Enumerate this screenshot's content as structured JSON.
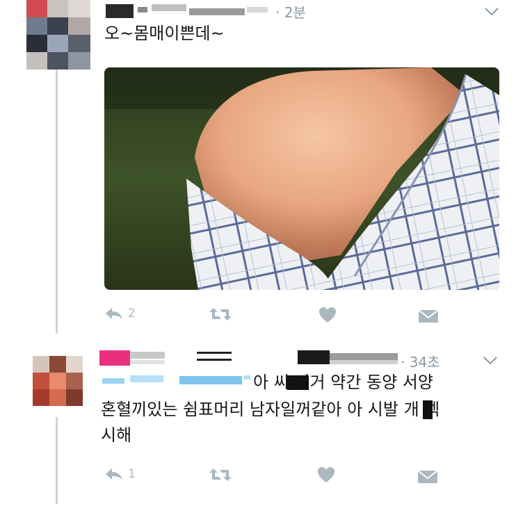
{
  "tweet1": {
    "time": "· 2분",
    "text": "오~몸매이쁜데~",
    "actions": {
      "reply_count": "2",
      "retweet_count": "",
      "like_count": ""
    }
  },
  "tweet2": {
    "time": "· 34초",
    "line1": "아 씨 이거 약간 동양 서양",
    "line2": "혼혈끼있는 쉼표머리 남자일꺼같아 아 시발 개 섹",
    "line3": "시해",
    "actions": {
      "reply_count": "1",
      "retweet_count": "",
      "like_count": ""
    }
  },
  "icons": [
    "reply-icon",
    "retweet-icon",
    "like-icon",
    "dm-icon",
    "chevron-down-icon"
  ],
  "colors": {
    "action_gray": "#aab8c2",
    "meta_gray": "#8899a6",
    "thread_line": "#ccd6dd",
    "redact_pink": "#e8307f"
  }
}
